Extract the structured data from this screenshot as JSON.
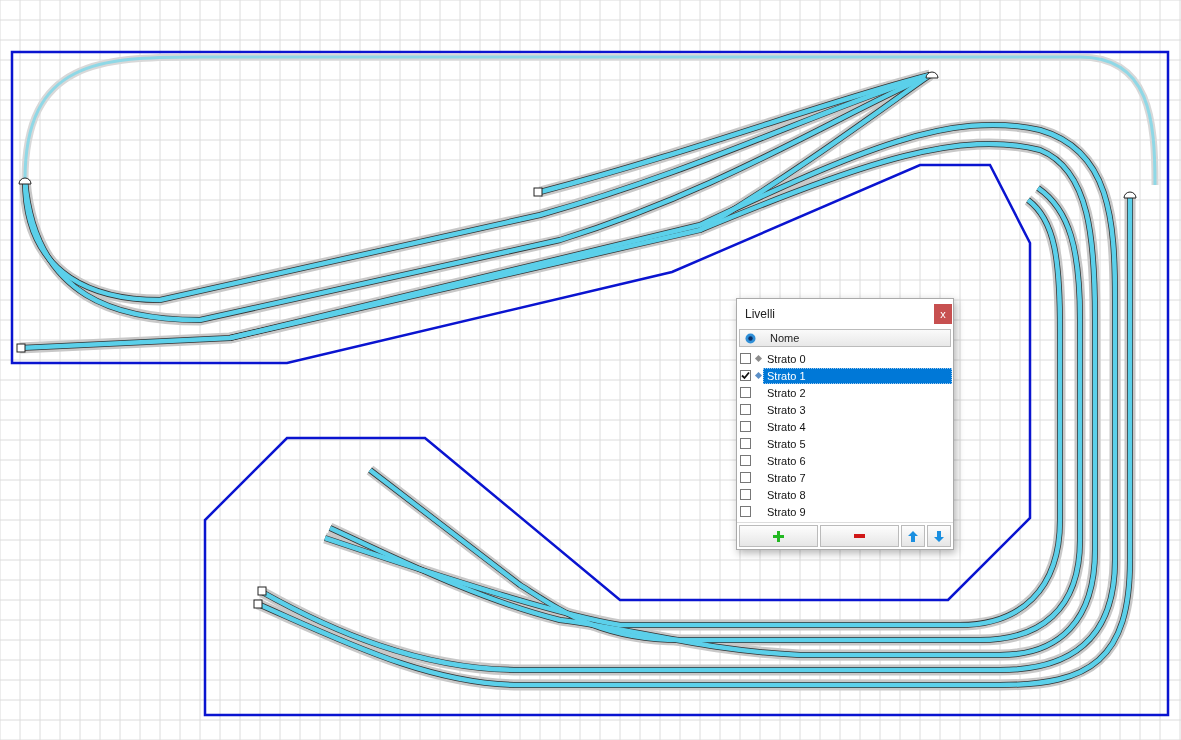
{
  "panel": {
    "title": "Livelli",
    "close": "x",
    "column_header": "Nome",
    "layers": [
      {
        "name": "Strato 0",
        "checked": false,
        "selected": false,
        "color": "#8c8c8c"
      },
      {
        "name": "Strato 1",
        "checked": true,
        "selected": true,
        "color": "#5b8fc7"
      },
      {
        "name": "Strato 2",
        "checked": false,
        "selected": false
      },
      {
        "name": "Strato 3",
        "checked": false,
        "selected": false
      },
      {
        "name": "Strato 4",
        "checked": false,
        "selected": false
      },
      {
        "name": "Strato 5",
        "checked": false,
        "selected": false
      },
      {
        "name": "Strato 6",
        "checked": false,
        "selected": false
      },
      {
        "name": "Strato 7",
        "checked": false,
        "selected": false
      },
      {
        "name": "Strato 8",
        "checked": false,
        "selected": false
      },
      {
        "name": "Strato 9",
        "checked": false,
        "selected": false
      }
    ]
  }
}
